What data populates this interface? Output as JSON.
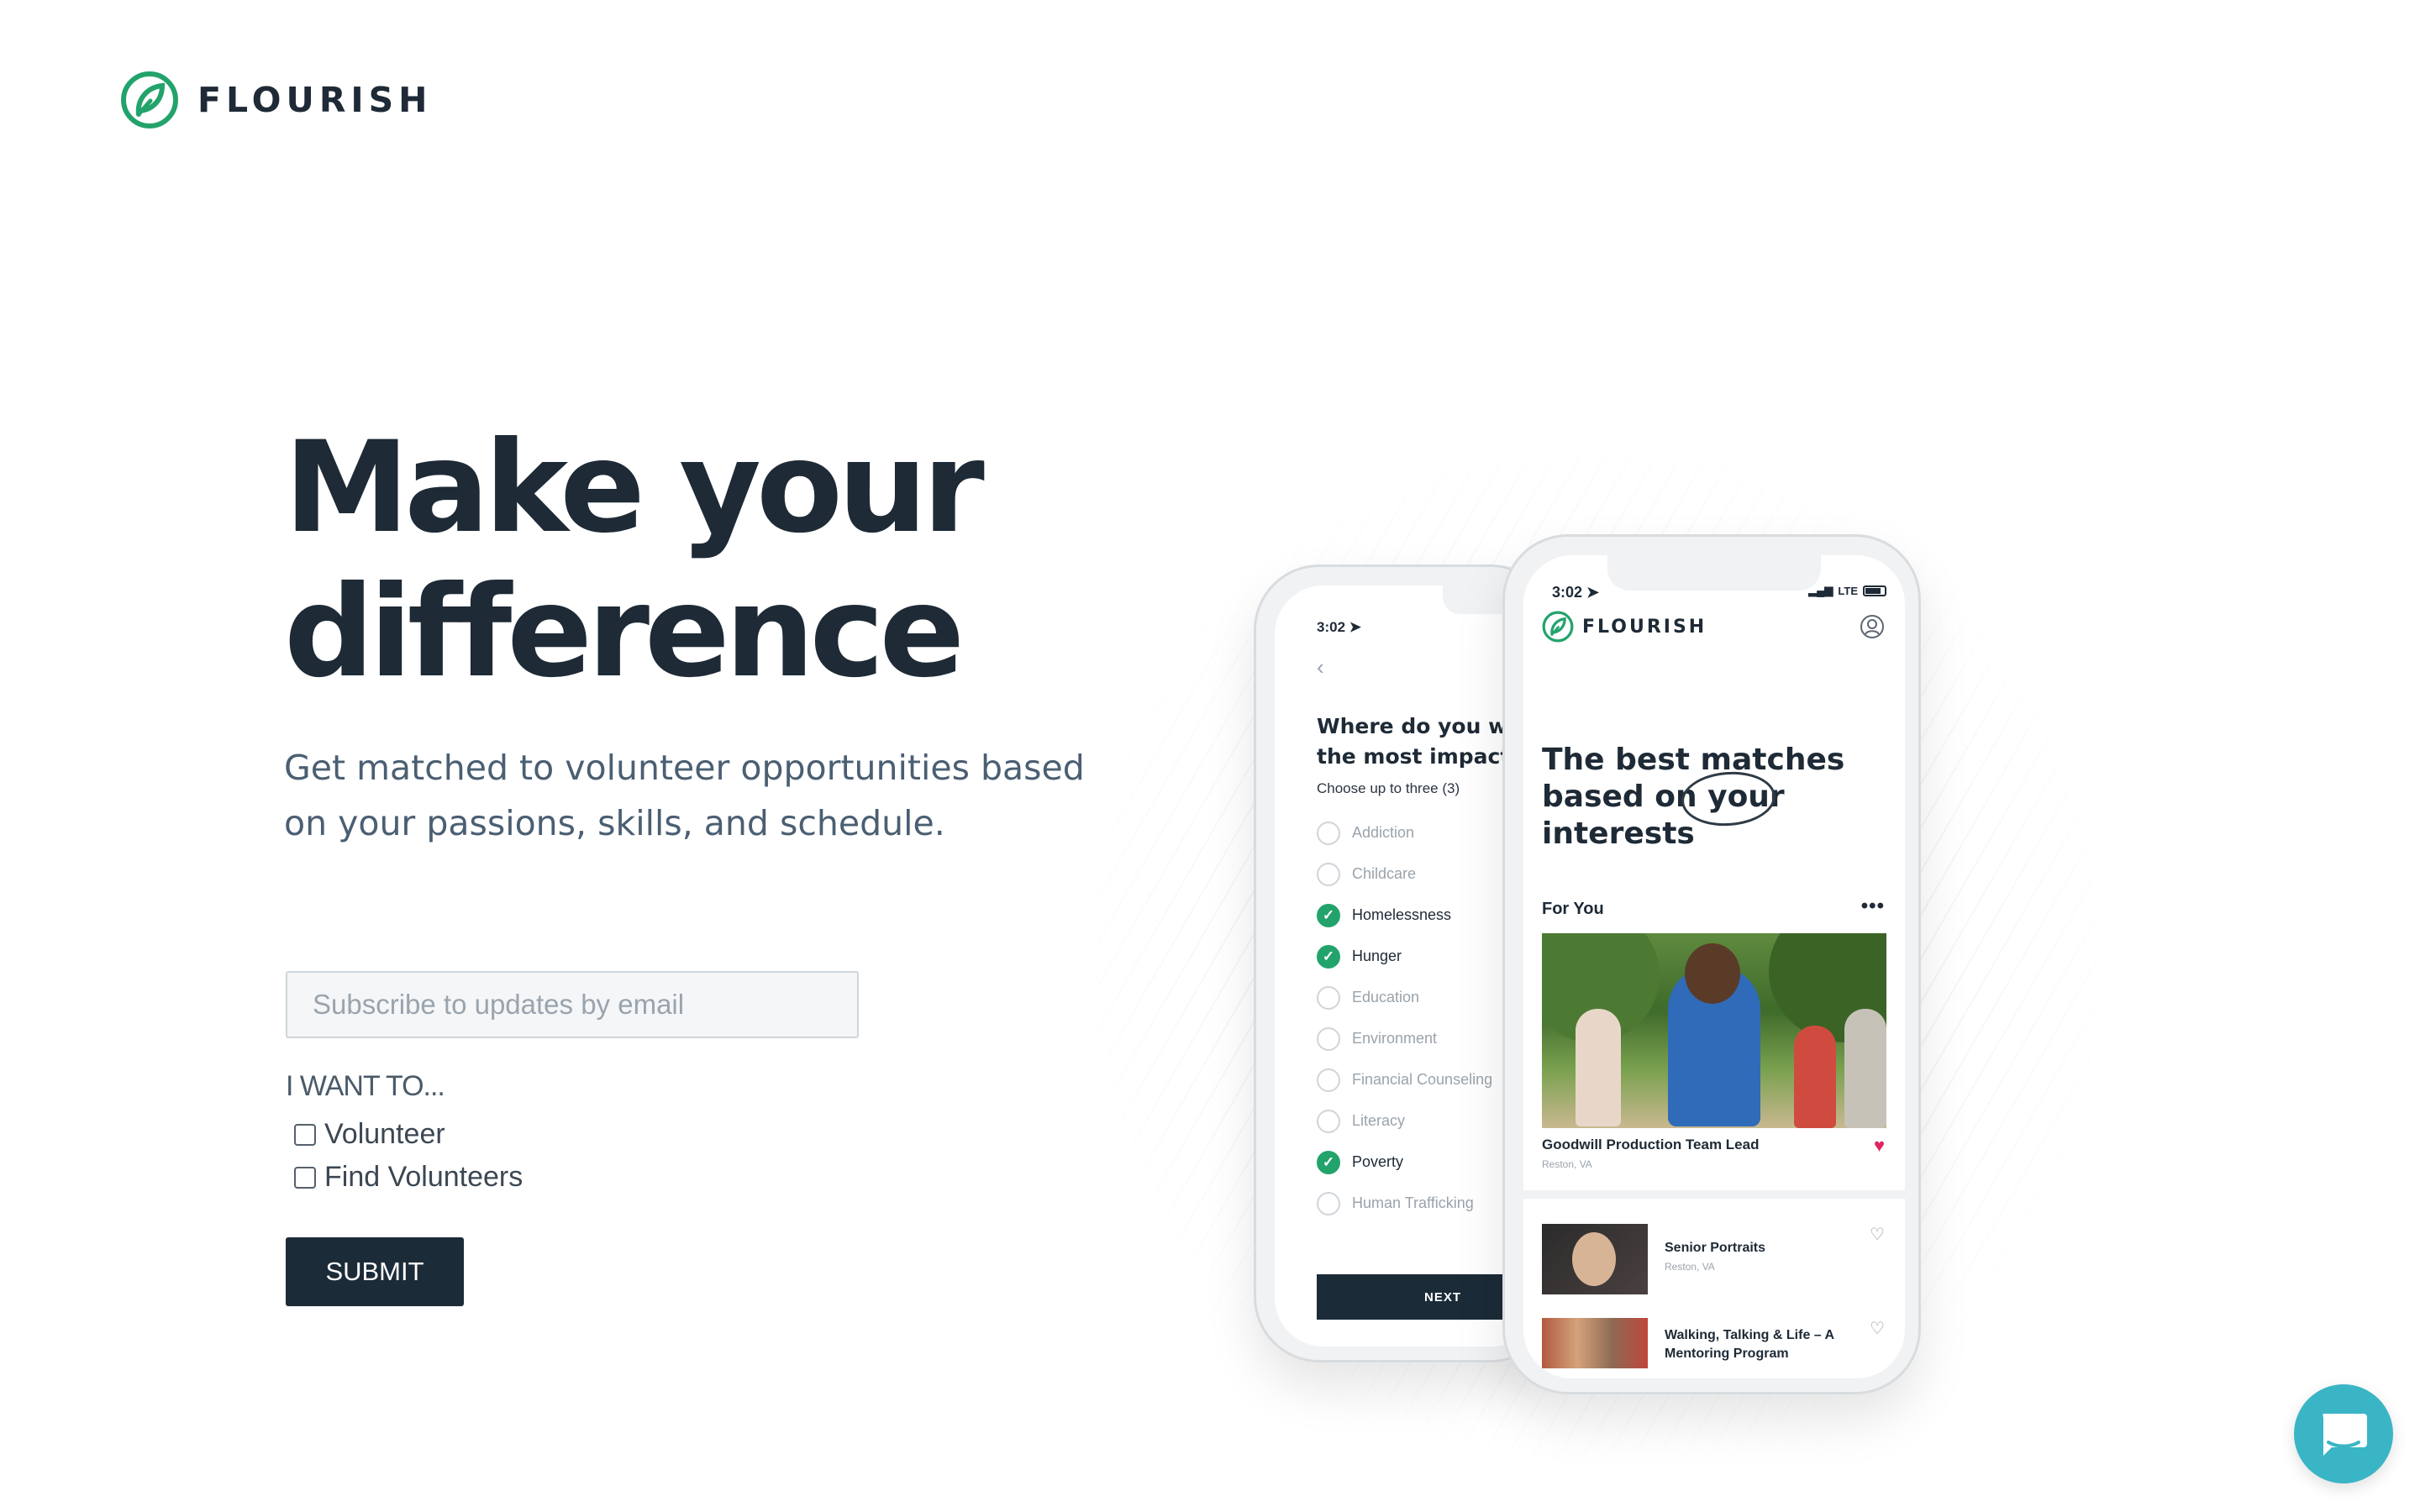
{
  "brand": {
    "name": "FLOURISH",
    "accent": "#23a36c"
  },
  "hero": {
    "title_line1": "Make your",
    "title_line2": "difference",
    "subtitle": "Get matched to volunteer opportunities based on your passions, skills, and schedule."
  },
  "form": {
    "email_placeholder": "Subscribe to updates by email",
    "email_value": "",
    "want_label": "I WANT TO...",
    "options": [
      {
        "label": "Volunteer",
        "checked": false
      },
      {
        "label": "Find Volunteers",
        "checked": false
      }
    ],
    "submit_label": "SUBMIT",
    "submit_color": "#1c2b38"
  },
  "phone_back": {
    "time": "3:02",
    "question": "Where do you want to make the most impact?",
    "hint": "Choose up to three (3)",
    "interests": [
      {
        "label": "Addiction",
        "selected": false
      },
      {
        "label": "Childcare",
        "selected": false
      },
      {
        "label": "Homelessness",
        "selected": true
      },
      {
        "label": "Hunger",
        "selected": true
      },
      {
        "label": "Education",
        "selected": false
      },
      {
        "label": "Environment",
        "selected": false
      },
      {
        "label": "Financial Counseling",
        "selected": false
      },
      {
        "label": "Literacy",
        "selected": false
      },
      {
        "label": "Poverty",
        "selected": true
      },
      {
        "label": "Human Trafficking",
        "selected": false
      }
    ],
    "next_label": "NEXT"
  },
  "phone_front": {
    "time": "3:02",
    "network": "LTE",
    "brand": "FLOURISH",
    "headline": "The best matches based on your interests",
    "section": "For You",
    "featured": {
      "title": "Goodwill Production Team Lead",
      "location": "Reston, VA"
    },
    "list": [
      {
        "title": "Senior Portraits",
        "location": "Reston, VA"
      },
      {
        "title": "Walking, Talking & Life – A Mentoring Program",
        "location": ""
      }
    ]
  },
  "chat": {
    "color": "#3ab5c6",
    "icon": "chat-bubble-icon"
  }
}
